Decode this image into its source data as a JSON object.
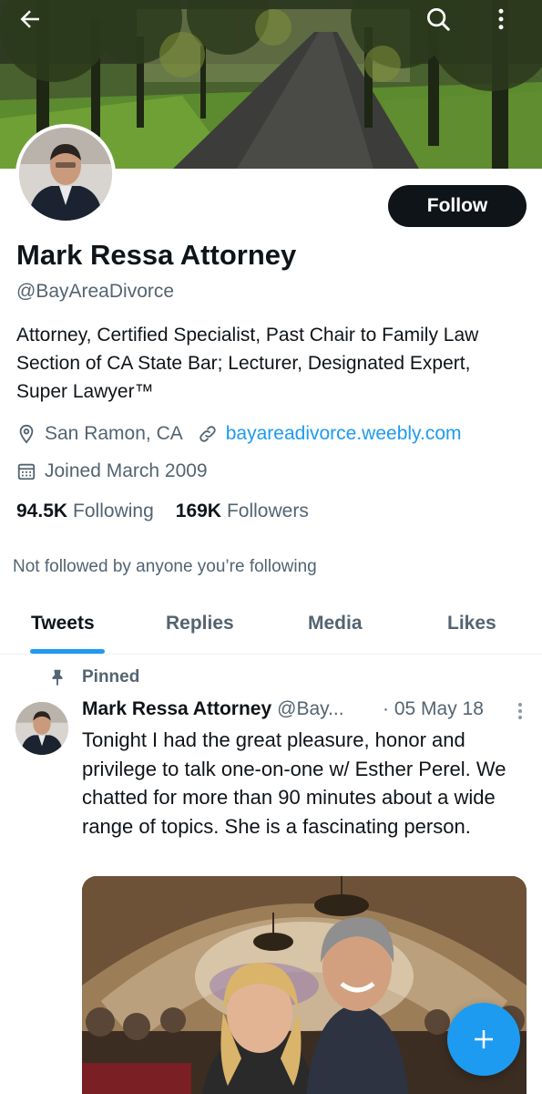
{
  "header": {
    "back_icon": "arrow-left-icon",
    "search_icon": "search-icon",
    "more_icon": "more-vertical-icon"
  },
  "profile": {
    "name": "Mark Ressa Attorney",
    "handle": "@BayAreaDivorce",
    "follow_label": "Follow",
    "bio": "Attorney, Certified Specialist, Past Chair to Family Law Section of CA State Bar; Lecturer, Designated Expert, Super Lawyer™",
    "location": "San Ramon, CA",
    "website": "bayareadivorce.weebly.com",
    "joined": "Joined March 2009",
    "following_count": "94.5K",
    "following_label": "Following",
    "followers_count": "169K",
    "followers_label": "Followers",
    "not_followed_text": "Not followed by anyone you’re following"
  },
  "tabs": [
    {
      "label": "Tweets",
      "active": true
    },
    {
      "label": "Replies",
      "active": false
    },
    {
      "label": "Media",
      "active": false
    },
    {
      "label": "Likes",
      "active": false
    }
  ],
  "tweet": {
    "pinned_label": "Pinned",
    "author_name": "Mark Ressa Attorney",
    "author_handle": "@Bay...",
    "date": "· 05 May 18",
    "text": "Tonight I had the great pleasure, honor and privilege to talk one-on-one w/ Esther Perel. We chatted for more than 90 minutes about a wide range of topics. She is a fascinating person."
  },
  "fab": {
    "icon": "plus-icon"
  },
  "colors": {
    "accent": "#1d9bf0",
    "text_primary": "#0f1419",
    "text_secondary": "#536471",
    "follow_button_bg": "#0f1419"
  }
}
